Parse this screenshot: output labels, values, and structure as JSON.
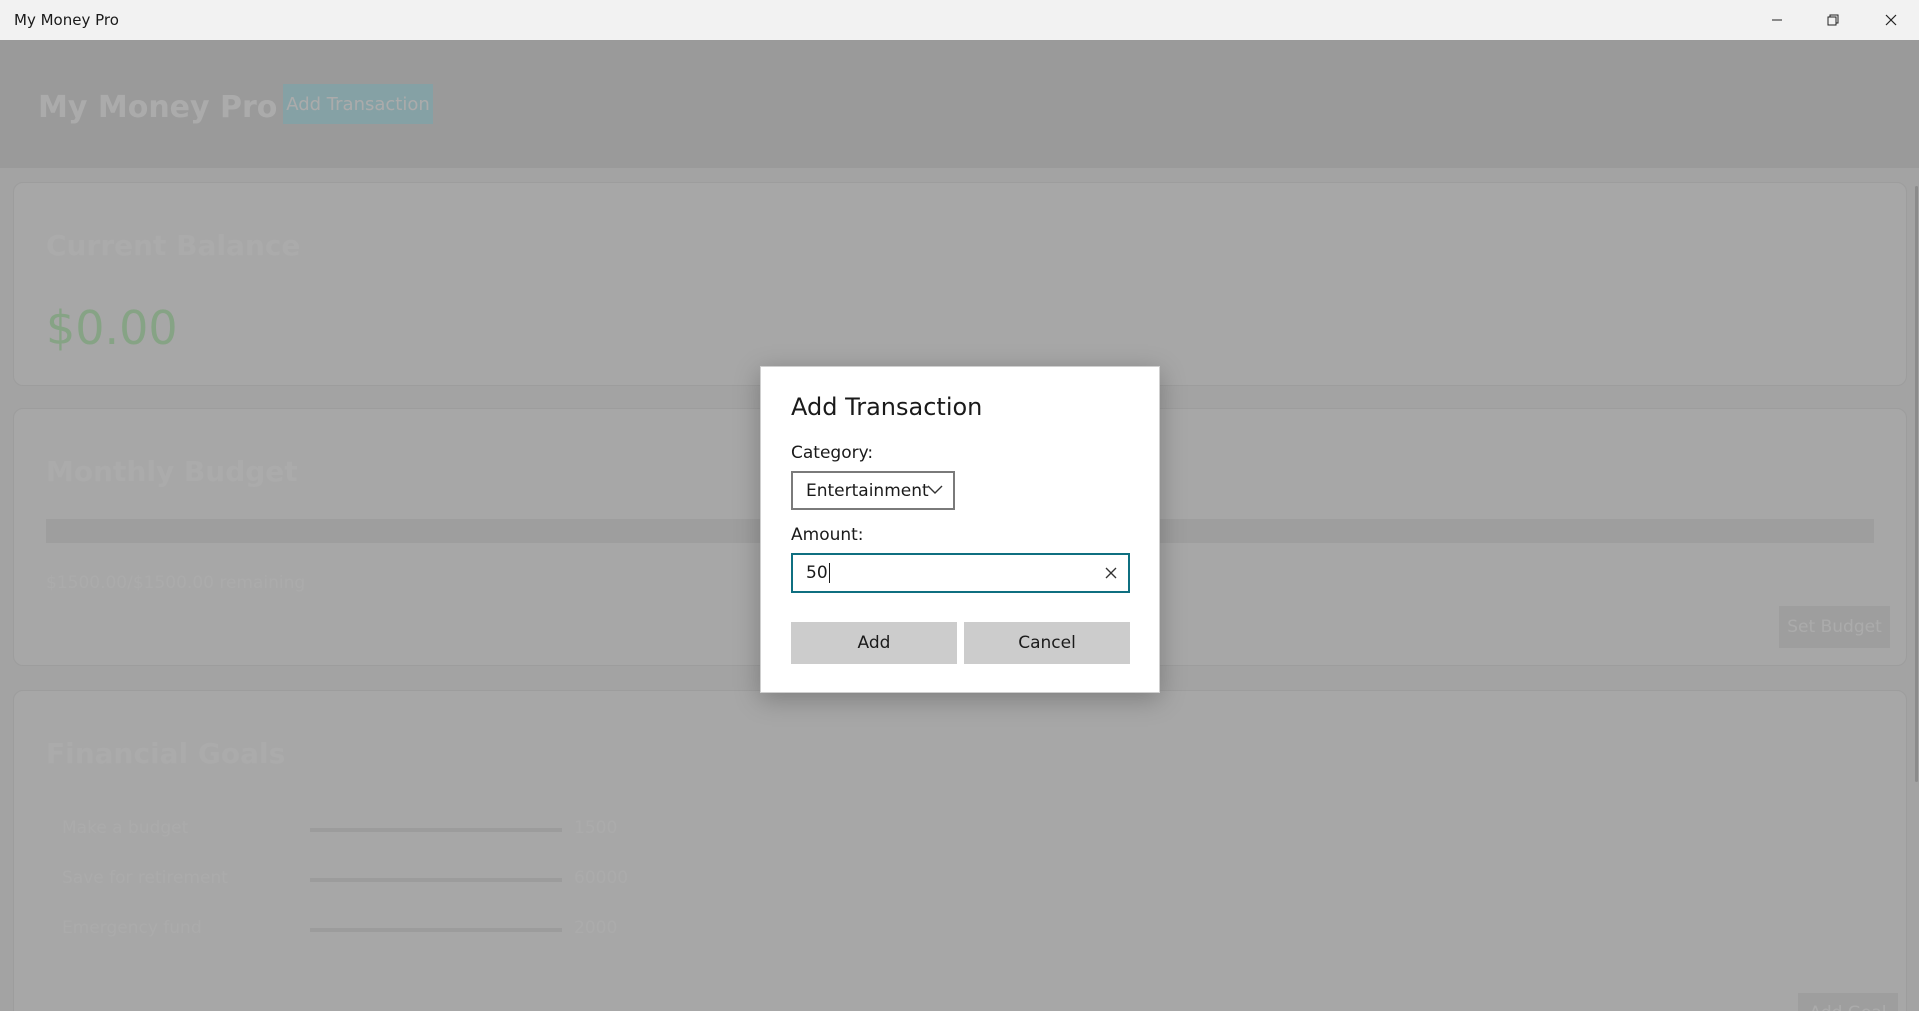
{
  "window": {
    "title": "My Money Pro"
  },
  "header": {
    "title": "My Money Pro",
    "add_transaction_label": "Add Transaction"
  },
  "balance": {
    "title": "Current Balance",
    "value": "$0.00"
  },
  "budget": {
    "title": "Monthly Budget",
    "remaining_text": "$1500.00/$1500.00 remaining",
    "set_budget_label": "Set Budget"
  },
  "goals": {
    "title": "Financial Goals",
    "items": [
      {
        "name": "Make a budget",
        "amount": "1500"
      },
      {
        "name": "Save for retirement",
        "amount": "60000"
      },
      {
        "name": "Emergency fund",
        "amount": "2000"
      }
    ],
    "add_goal_label": "Add Goal"
  },
  "dialog": {
    "title": "Add Transaction",
    "category_label": "Category:",
    "category_value": "Entertainment",
    "amount_label": "Amount:",
    "amount_value": "50",
    "add_label": "Add",
    "cancel_label": "Cancel"
  },
  "colors": {
    "accent_border": "#0f6f80",
    "balance_green": "#c8f3c6",
    "header_button": "#c7f0f7"
  },
  "icons": {
    "minimize": "minimize-icon",
    "maximize": "restore-icon",
    "close": "close-icon",
    "dropdown": "chevron-down-icon",
    "clear": "clear-icon"
  }
}
